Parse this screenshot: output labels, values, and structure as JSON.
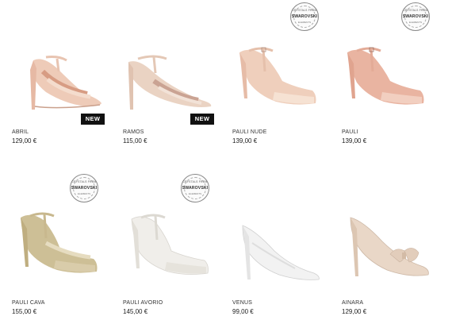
{
  "products": [
    {
      "name": "ABRIL",
      "price": "129,00 €",
      "badge": "NEW",
      "seal": false
    },
    {
      "name": "RAMOS",
      "price": "115,00 €",
      "badge": "NEW",
      "seal": false
    },
    {
      "name": "PAULI NUDE",
      "price": "139,00 €",
      "badge": "",
      "seal": true
    },
    {
      "name": "PAULI",
      "price": "139,00 €",
      "badge": "",
      "seal": true
    },
    {
      "name": "PAULI CAVA",
      "price": "155,00 €",
      "badge": "",
      "seal": true
    },
    {
      "name": "PAULI AVORIO",
      "price": "145,00 €",
      "badge": "",
      "seal": true
    },
    {
      "name": "VENUS",
      "price": "99,00 €",
      "badge": "",
      "seal": false
    },
    {
      "name": "AINARA",
      "price": "129,00 €",
      "badge": "",
      "seal": false
    }
  ],
  "seal": {
    "top_text": "CRYSTALS FROM",
    "brand": "SWAROVSKI",
    "bottom_text": "ELEMENTS"
  },
  "colors": {
    "abril": "#eecbb8",
    "ramos": "#ead3c3",
    "pauli_nude": "#efcfbc",
    "pauli": "#e9b4a1",
    "pauli_cava": "#cdbf96",
    "pauli_avorio": "#f0eeea",
    "venus": "#f2f2f2",
    "ainara": "#e9d7c7"
  }
}
